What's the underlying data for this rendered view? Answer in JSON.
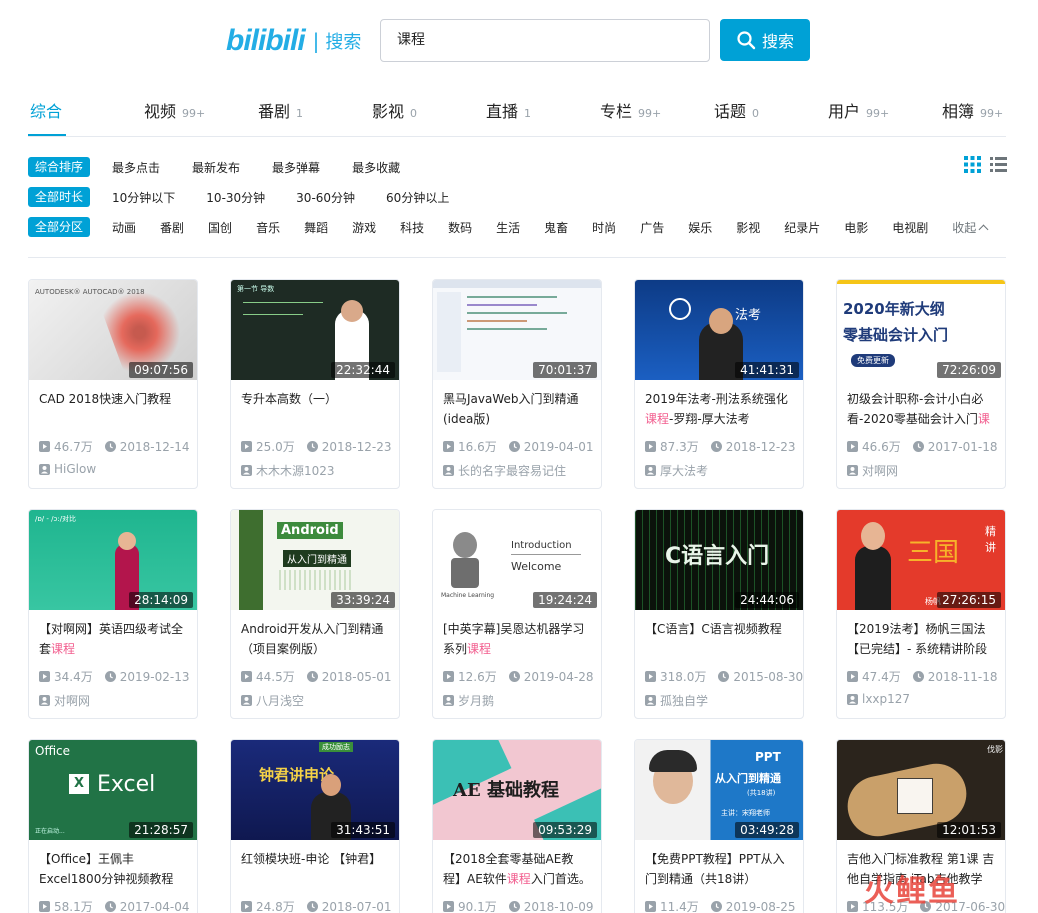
{
  "header": {
    "logo": "bilibili",
    "logo_sub": "搜索",
    "search_value": "课程",
    "search_button": "搜索"
  },
  "tabs": [
    {
      "label": "综合",
      "count": ""
    },
    {
      "label": "视频",
      "count": "99+"
    },
    {
      "label": "番剧",
      "count": "1"
    },
    {
      "label": "影视",
      "count": "0"
    },
    {
      "label": "直播",
      "count": "1"
    },
    {
      "label": "专栏",
      "count": "99+"
    },
    {
      "label": "话题",
      "count": "0"
    },
    {
      "label": "用户",
      "count": "99+"
    },
    {
      "label": "相簿",
      "count": "99+"
    }
  ],
  "filters": {
    "sort": {
      "chip": "综合排序",
      "options": [
        "最多点击",
        "最新发布",
        "最多弹幕",
        "最多收藏"
      ]
    },
    "duration": {
      "chip": "全部时长",
      "options": [
        "10分钟以下",
        "10-30分钟",
        "30-60分钟",
        "60分钟以上"
      ]
    },
    "zone": {
      "chip": "全部分区",
      "options": [
        "动画",
        "番剧",
        "国创",
        "音乐",
        "舞蹈",
        "游戏",
        "科技",
        "数码",
        "生活",
        "鬼畜",
        "时尚",
        "广告",
        "娱乐",
        "影视",
        "纪录片",
        "电影",
        "电视剧",
        "收起"
      ]
    }
  },
  "colors": {
    "accent": "#00a1d6",
    "highlight": "#f25d8e",
    "meta": "#99a2aa"
  },
  "icons": {
    "play": "play-icon",
    "date": "clock-icon",
    "uploader": "user-icon",
    "grid": "grid-view-icon",
    "list": "list-view-icon",
    "search": "search-icon"
  },
  "videos": [
    {
      "duration": "09:07:56",
      "title_pre": "CAD 2018快速入门教程",
      "title_hl": "",
      "title_post": "",
      "plays": "46.7万",
      "date": "2018-12-14",
      "up": "HiGlow",
      "thumb_text": "AUTODESK® AUTOCAD® 2018"
    },
    {
      "duration": "22:32:44",
      "title_pre": "专升本高数（一）",
      "title_hl": "",
      "title_post": "",
      "plays": "25.0万",
      "date": "2018-12-23",
      "up": "木木木源1023",
      "thumb_text": "第一节 导数"
    },
    {
      "duration": "70:01:37",
      "title_pre": "黑马JavaWeb入门到精通(idea版)",
      "title_hl": "",
      "title_post": "",
      "plays": "16.6万",
      "date": "2019-04-01",
      "up": "长的名字最容易记住",
      "thumb_text": ""
    },
    {
      "duration": "41:41:31",
      "title_pre": "2019年法考-刑法系统强化",
      "title_hl": "课程",
      "title_post": "-罗翔-厚大法考",
      "plays": "87.3万",
      "date": "2018-12-23",
      "up": "厚大法考",
      "thumb_text": "法考"
    },
    {
      "duration": "72:26:09",
      "title_pre": "初级会计职称-会计小白必看-2020零基础会计入门",
      "title_hl": "课",
      "title_post": "",
      "plays": "46.6万",
      "date": "2017-01-18",
      "up": "对啊网",
      "thumb_text": "2020年新大纲|零基础会计入门|免费更新"
    },
    {
      "duration": "28:14:09",
      "title_pre": "【对啊网】英语四级考试全套",
      "title_hl": "课程",
      "title_post": "",
      "plays": "34.4万",
      "date": "2019-02-13",
      "up": "对啊网",
      "thumb_text": "/ɒ/ - /ɔ:/对比"
    },
    {
      "duration": "33:39:24",
      "title_pre": "Android开发从入门到精通（项目案例版）",
      "title_hl": "",
      "title_post": "",
      "plays": "44.5万",
      "date": "2018-05-01",
      "up": "八月浅空",
      "thumb_text": "Android|从入门到精通"
    },
    {
      "duration": "19:24:24",
      "title_pre": "[中英字幕]吴恩达机器学习系列",
      "title_hl": "课程",
      "title_post": "",
      "plays": "12.6万",
      "date": "2019-04-28",
      "up": "岁月鹅",
      "thumb_text": "Introduction|Welcome|Machine Learning"
    },
    {
      "duration": "24:44:06",
      "title_pre": "【C语言】C语言视频教程",
      "title_hl": "",
      "title_post": "",
      "plays": "318.0万",
      "date": "2015-08-30",
      "up": "孤独自学",
      "thumb_text": "C语言入门"
    },
    {
      "duration": "27:26:15",
      "title_pre": "【2019法考】杨帆三国法【已完结】- 系统精讲阶段",
      "title_hl": "",
      "title_post": "",
      "plays": "47.4万",
      "date": "2018-11-18",
      "up": "lxxp127",
      "thumb_text": "三国|精讲|杨帆"
    },
    {
      "duration": "21:28:57",
      "title_pre": "【Office】王佩丰Excel1800分钟视频教程",
      "title_hl": "",
      "title_post": "",
      "plays": "58.1万",
      "date": "2017-04-04",
      "up": "",
      "thumb_text": "Office|Excel|正在启动..."
    },
    {
      "duration": "31:43:51",
      "title_pre": "红领模块班-申论 【钟君】",
      "title_hl": "",
      "title_post": "",
      "plays": "24.8万",
      "date": "2018-07-01",
      "up": "",
      "thumb_text": "钟君讲申论|成功励志"
    },
    {
      "duration": "09:53:29",
      "title_pre": "【2018全套零基础AE教程】AE软件",
      "title_hl": "课程",
      "title_post": "入门首选。",
      "plays": "90.1万",
      "date": "2018-10-09",
      "up": "",
      "thumb_text": "AE 基础教程"
    },
    {
      "duration": "03:49:28",
      "title_pre": "【免费PPT教程】PPT从入门到精通（共18讲）",
      "title_hl": "",
      "title_post": "",
      "plays": "11.4万",
      "date": "2019-08-25",
      "up": "",
      "thumb_text": "PPT|从入门到精通|(共18讲)|主讲：宋翔老师"
    },
    {
      "duration": "12:01:53",
      "title_pre": "吉他入门标准教程 第1课 吉他自学指南 iTab吉他教学",
      "title_hl": "",
      "title_post": "",
      "plays": "113.5万",
      "date": "2017-06-30",
      "up": "",
      "thumb_text": "伐影"
    }
  ],
  "watermark": "火鲤鱼"
}
